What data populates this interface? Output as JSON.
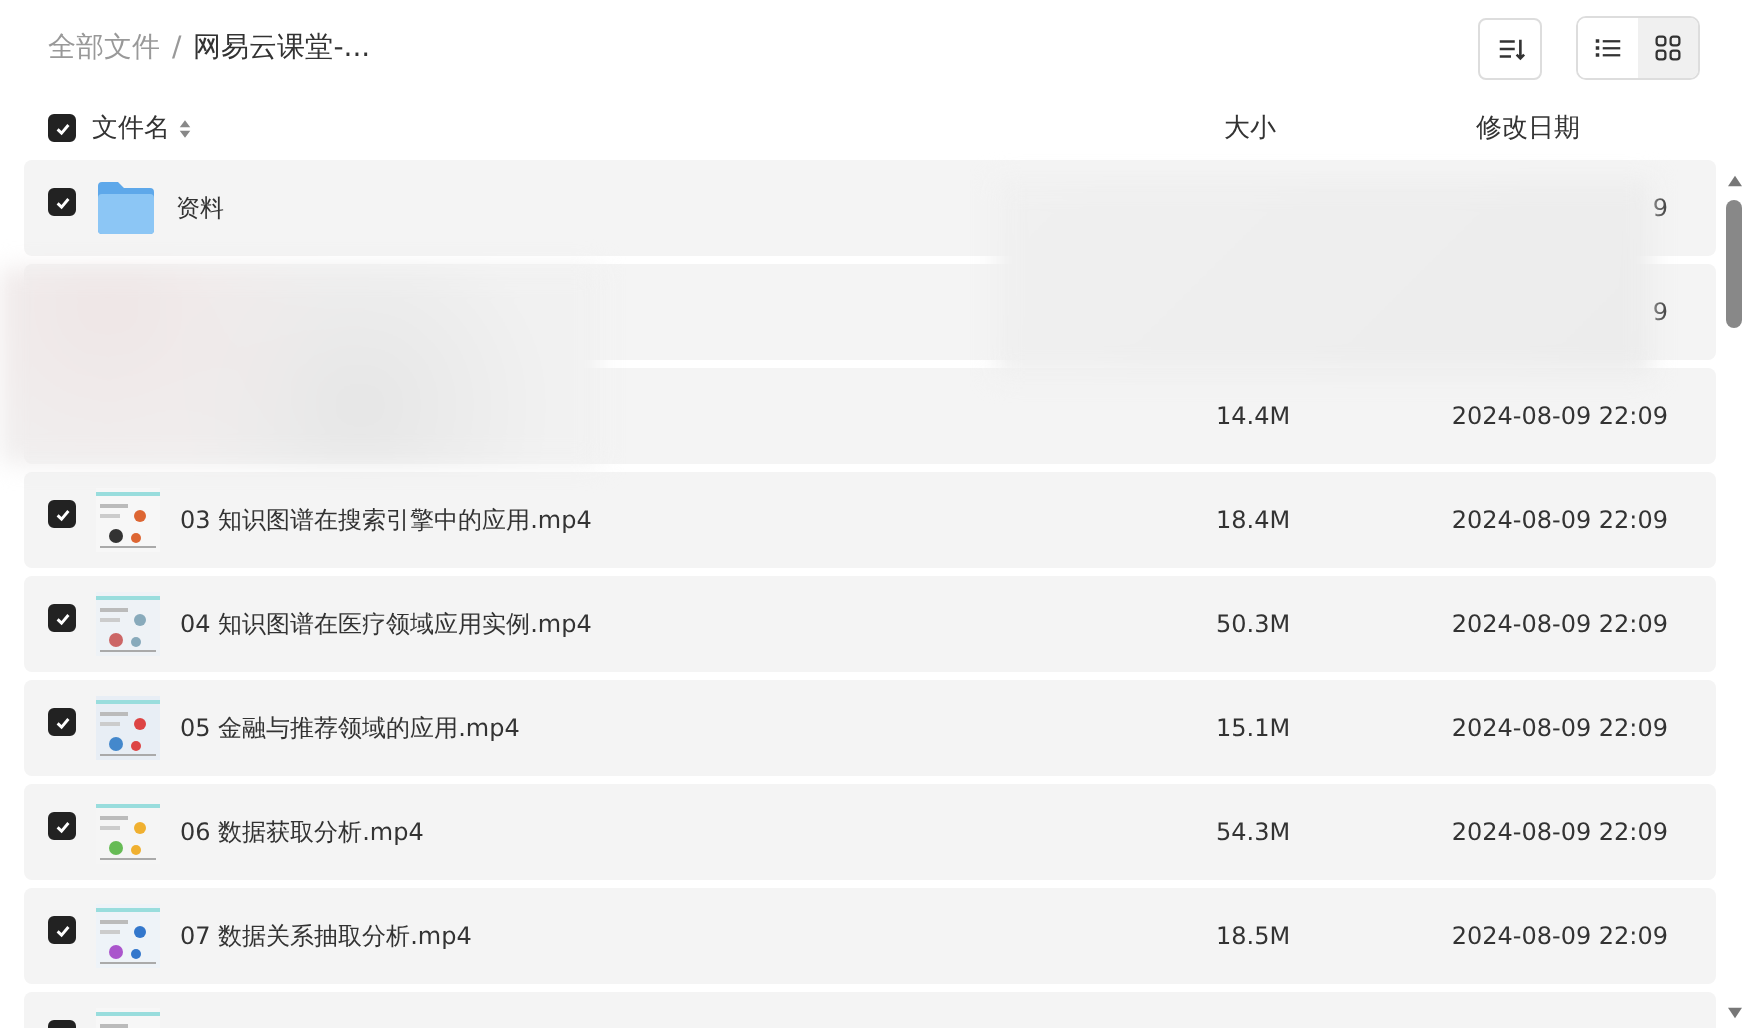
{
  "breadcrumb_separator": "/",
  "breadcrumb": [
    {
      "label": "全部文件",
      "current": false
    },
    {
      "label": "网易云课堂-...",
      "current": true
    }
  ],
  "toolbar": {
    "views": [
      {
        "kind": "list",
        "selected": false
      },
      {
        "kind": "grid",
        "selected": true
      }
    ]
  },
  "header": {
    "checked": true,
    "columns": [
      "文件名",
      "大小",
      "修改日期"
    ]
  },
  "rows": [
    {
      "kind": "folder",
      "checked": true,
      "name": "资料",
      "size": "",
      "date": "9"
    },
    {
      "kind": "covered",
      "name": "",
      "size": "",
      "date": "9"
    },
    {
      "kind": "covered",
      "name": "",
      "size": "14.4M",
      "date": "2024-08-09 22:09"
    },
    {
      "kind": "video",
      "checked": true,
      "name": "03 知识图谱在搜索引擎中的应用.mp4",
      "size": "18.4M",
      "date": "2024-08-09 22:09"
    },
    {
      "kind": "video",
      "checked": true,
      "name": "04 知识图谱在医疗领域应用实例.mp4",
      "size": "50.3M",
      "date": "2024-08-09 22:09"
    },
    {
      "kind": "video",
      "checked": true,
      "name": "05 金融与推荐领域的应用.mp4",
      "size": "15.1M",
      "date": "2024-08-09 22:09"
    },
    {
      "kind": "video",
      "checked": true,
      "name": "06 数据获取分析.mp4",
      "size": "54.3M",
      "date": "2024-08-09 22:09"
    },
    {
      "kind": "video",
      "checked": true,
      "name": "07 数据关系抽取分析.mp4",
      "size": "18.5M",
      "date": "2024-08-09 22:09"
    },
    {
      "kind": "video",
      "checked": true,
      "name": "",
      "size": "",
      "date": ""
    }
  ]
}
